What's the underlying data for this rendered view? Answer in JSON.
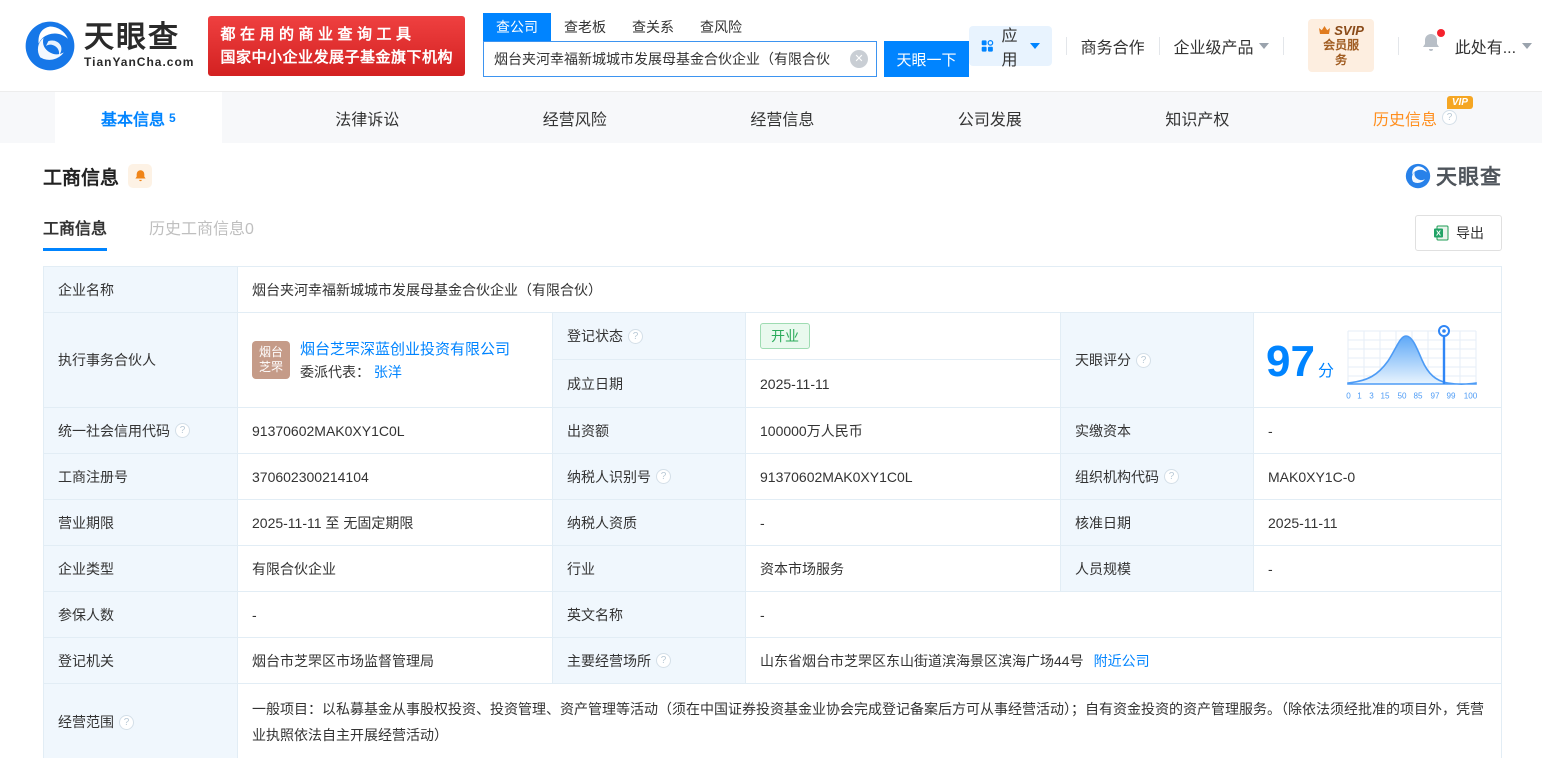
{
  "colors": {
    "accent": "#0084ff",
    "status_open_green": "#2bab5b",
    "banner_red": "#e02e2e",
    "vip_orange": "#f5a623",
    "history_tab_orange": "#ff8f1f"
  },
  "brand": {
    "name": "天眼查",
    "domain": "TianYanCha.com",
    "slogan_line1": "都在用的商业查询工具",
    "slogan_line2": "国家中小企业发展子基金旗下机构",
    "watermark_name": "天眼查"
  },
  "search": {
    "tabs": [
      {
        "label": "查公司"
      },
      {
        "label": "查老板"
      },
      {
        "label": "查关系"
      },
      {
        "label": "查风险"
      }
    ],
    "value": "烟台夹河幸福新城城市发展母基金合伙企业（有限合伙",
    "button_label": "天眼一下"
  },
  "header_menu": {
    "apps_label": "应用",
    "cooperation_label": "商务合作",
    "enterprise_label": "企业级产品",
    "svip_title": "SVIP",
    "svip_subtitle": "会员服务",
    "username": "此处有..."
  },
  "nav": {
    "tabs": [
      {
        "label": "基本信息",
        "count": "5"
      },
      {
        "label": "法律诉讼"
      },
      {
        "label": "经营风险"
      },
      {
        "label": "经营信息"
      },
      {
        "label": "公司发展"
      },
      {
        "label": "知识产权"
      },
      {
        "label": "历史信息",
        "badge": "VIP"
      }
    ]
  },
  "section": {
    "title": "工商信息",
    "subtab_current": "工商信息",
    "subtab_history": "历史工商信息",
    "subtab_history_count": "0",
    "export_label": "导出"
  },
  "info": {
    "company_name_label": "企业名称",
    "company_name": "烟台夹河幸福新城城市发展母基金合伙企业（有限合伙）",
    "partner_label": "执行事务合伙人",
    "partner_avatar_line1": "烟台",
    "partner_avatar_line2": "芝罘",
    "partner_company": "烟台芝罘深蓝创业投资有限公司",
    "delegate_label": "委派代表：",
    "delegate_name": "张洋",
    "reg_status_label": "登记状态",
    "reg_status_value": "开业",
    "establish_label": "成立日期",
    "establish_value": "2025-11-11",
    "score_label": "天眼评分"
  },
  "chart_data": {
    "type": "area",
    "title": "天眼评分",
    "score": 97,
    "score_display": "97",
    "score_unit": "分",
    "x_ticks": [
      "0",
      "1",
      "3",
      "15",
      "50",
      "85",
      "97",
      "99",
      "100"
    ],
    "marker_value": 97,
    "curve": "bell-distribution",
    "legend": "none",
    "accent_color": "#0084ff"
  },
  "table": {
    "rows6": [
      {
        "c1_label": "统一社会信用代码",
        "c1_value": "91370602MAK0XY1C0L",
        "c2_label": "出资额",
        "c2_value": "100000万人民币",
        "c3_label": "实缴资本",
        "c3_value": "-"
      },
      {
        "c1_label": "工商注册号",
        "c1_value": "370602300214104",
        "c2_label": "纳税人识别号",
        "c2_value": "91370602MAK0XY1C0L",
        "c3_label": "组织机构代码",
        "c3_value": "MAK0XY1C-0"
      },
      {
        "c1_label": "营业期限",
        "c1_value": "2025-11-11 至 无固定期限",
        "c2_label": "纳税人资质",
        "c2_value": "-",
        "c3_label": "核准日期",
        "c3_value": "2025-11-11"
      },
      {
        "c1_label": "企业类型",
        "c1_value": "有限合伙企业",
        "c2_label": "行业",
        "c2_value": "资本市场服务",
        "c3_label": "人员规模",
        "c3_value": "-"
      }
    ],
    "insured_label": "参保人数",
    "insured_value": "-",
    "english_name_label": "英文名称",
    "english_name_value": "-",
    "authority_label": "登记机关",
    "authority_value": "烟台市芝罘区市场监督管理局",
    "address_label": "主要经营场所",
    "address_value": "山东省烟台市芝罘区东山街道滨海景区滨海广场44号",
    "address_link": "附近公司",
    "scope_label": "经营范围",
    "scope_value": "一般项目：以私募基金从事股权投资、投资管理、资产管理等活动（须在中国证券投资基金业协会完成登记备案后方可从事经营活动）；自有资金投资的资产管理服务。（除依法须经批准的项目外，凭营业执照依法自主开展经营活动）"
  }
}
